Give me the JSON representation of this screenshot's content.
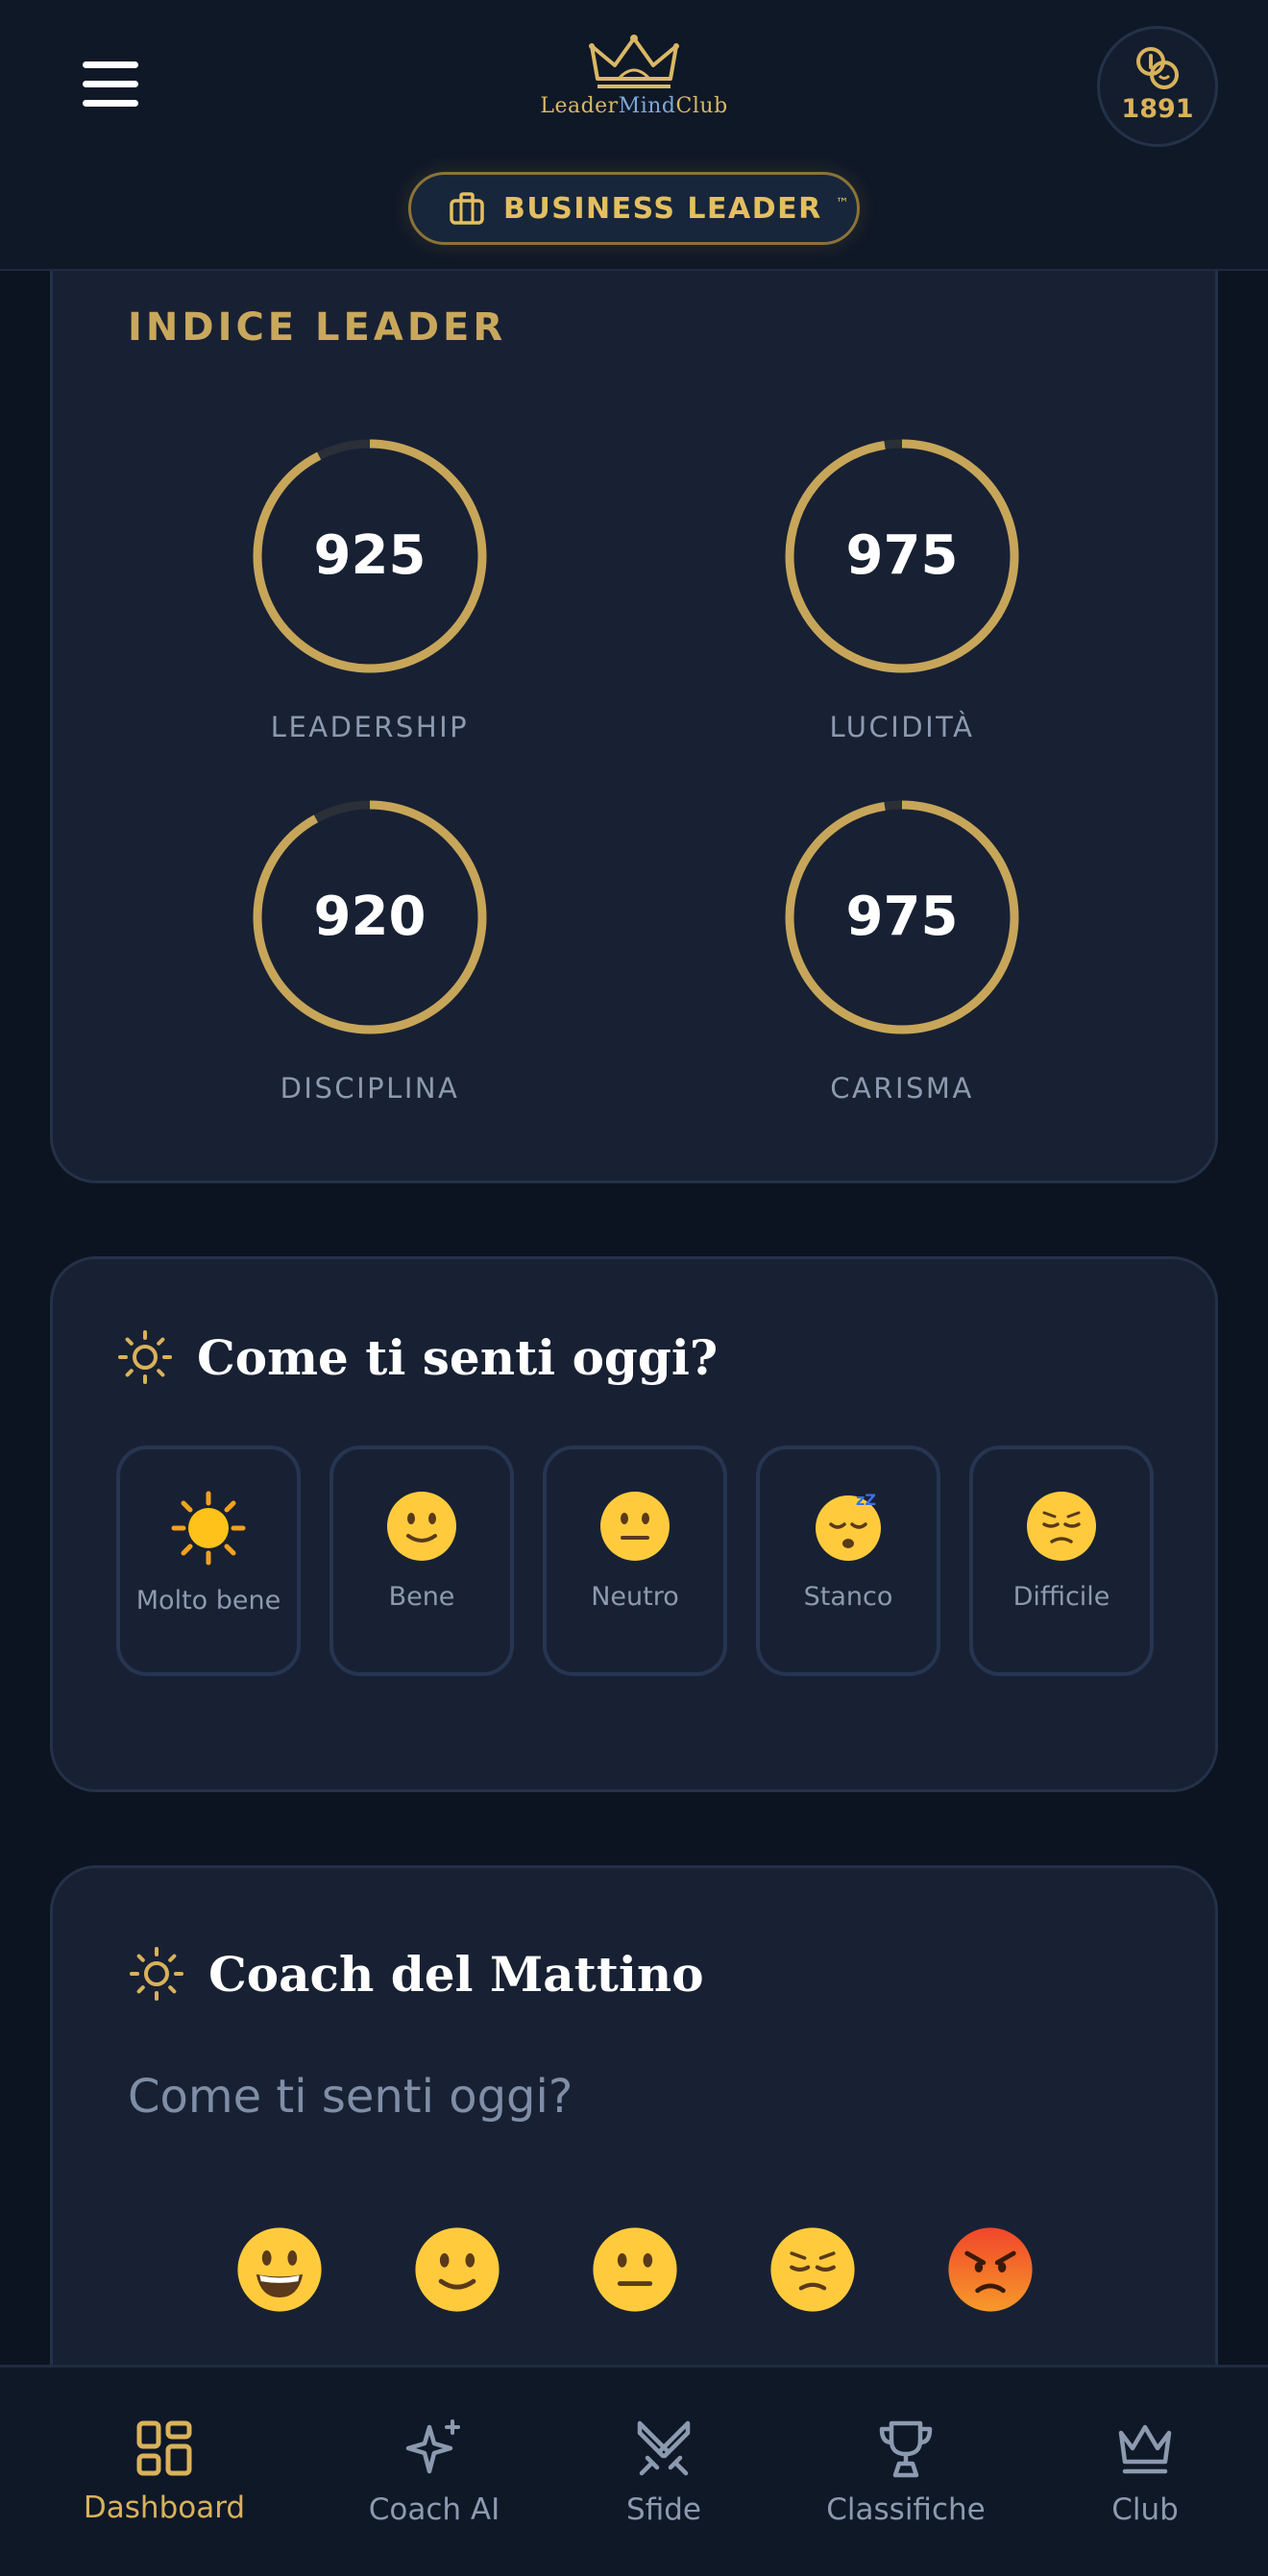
{
  "header": {
    "logo_text_a": "Leader",
    "logo_text_b": "Mind",
    "logo_text_c": "Club",
    "coins": "1891",
    "rank": "BUSINESS LEADER",
    "rank_mark": "™"
  },
  "index": {
    "title": "INDICE LEADER",
    "items": [
      {
        "label": "LEADERSHIP",
        "value": "925",
        "fraction": 0.925
      },
      {
        "label": "LUCIDITÀ",
        "value": "975",
        "fraction": 0.975
      },
      {
        "label": "DISCIPLINA",
        "value": "920",
        "fraction": 0.92
      },
      {
        "label": "CARISMA",
        "value": "975",
        "fraction": 0.975
      }
    ]
  },
  "mood": {
    "title": "Come ti senti oggi?",
    "icon": "sun-icon",
    "options": [
      {
        "label": "Molto bene",
        "icon": "sun-emoji"
      },
      {
        "label": "Bene",
        "icon": "slightly-smiling-emoji"
      },
      {
        "label": "Neutro",
        "icon": "neutral-face-emoji"
      },
      {
        "label": "Stanco",
        "icon": "sleeping-face-emoji"
      },
      {
        "label": "Difficile",
        "icon": "pensive-face-emoji"
      }
    ]
  },
  "coach": {
    "title": "Coach del Mattino",
    "question": "Come ti senti oggi?",
    "icon": "sun-icon",
    "emojis": [
      "grinning-face",
      "slightly-smiling-face",
      "neutral-face",
      "pensive-face",
      "angry-face"
    ]
  },
  "nav": {
    "items": [
      {
        "label": "Dashboard",
        "icon": "dashboard-icon",
        "active": true
      },
      {
        "label": "Coach AI",
        "icon": "sparkle-icon",
        "active": false
      },
      {
        "label": "Sfide",
        "icon": "swords-icon",
        "active": false
      },
      {
        "label": "Classifiche",
        "icon": "trophy-icon",
        "active": false
      },
      {
        "label": "Club",
        "icon": "crown-icon",
        "active": false
      }
    ]
  },
  "colors": {
    "accent": "#d9b25a",
    "background": "#0c1421",
    "card": "#182133",
    "muted": "#8c9ab0"
  }
}
